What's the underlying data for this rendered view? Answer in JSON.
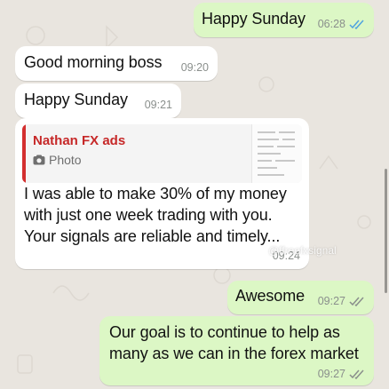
{
  "messages": [
    {
      "text": "Happy Sunday",
      "time": "06:28"
    },
    {
      "text": "Good morning boss",
      "time": "09:20"
    },
    {
      "text": "Happy Sunday",
      "time": "09:21"
    },
    {
      "quote": {
        "name": "Nathan FX ads",
        "type": "Photo"
      },
      "lines": [
        "I was able to make 30% of my money",
        "with just one week trading with you.",
        "Your signals are reliable and timely..."
      ],
      "time": "09:24"
    },
    {
      "text": "Awesome",
      "time": "09:27"
    },
    {
      "lines": [
        "Our goal is to continue to help as",
        "many as we can in the forex market"
      ],
      "time": "09:27"
    }
  ],
  "watermark": "@ffreefxsignal",
  "colors": {
    "outgoing": "#dcf7c5",
    "incoming": "#ffffff",
    "read_ticks": "#4fa3e0",
    "delivered_ticks": "#8a8f8c",
    "quote_accent": "#d32f2f"
  }
}
